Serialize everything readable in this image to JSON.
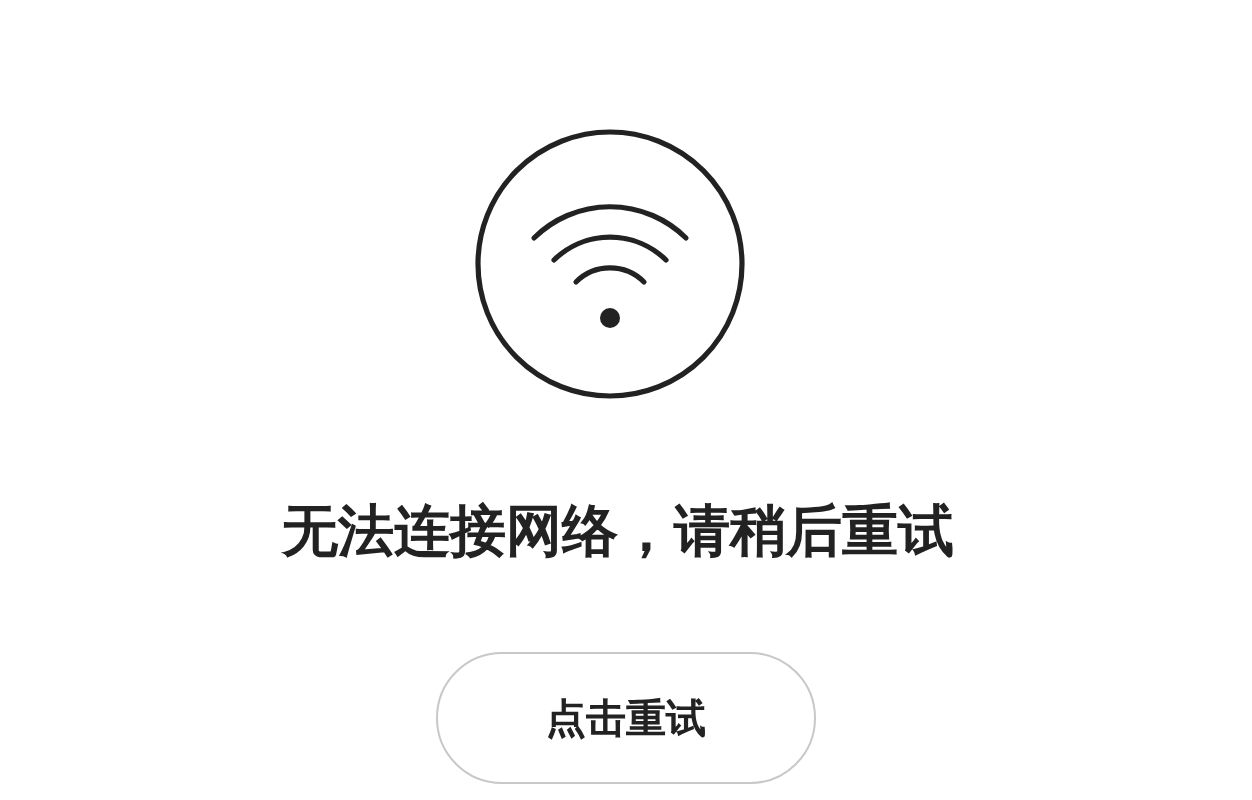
{
  "message": "无法连接网络，请稍后重试",
  "retry_button": {
    "label": "点击重试"
  }
}
